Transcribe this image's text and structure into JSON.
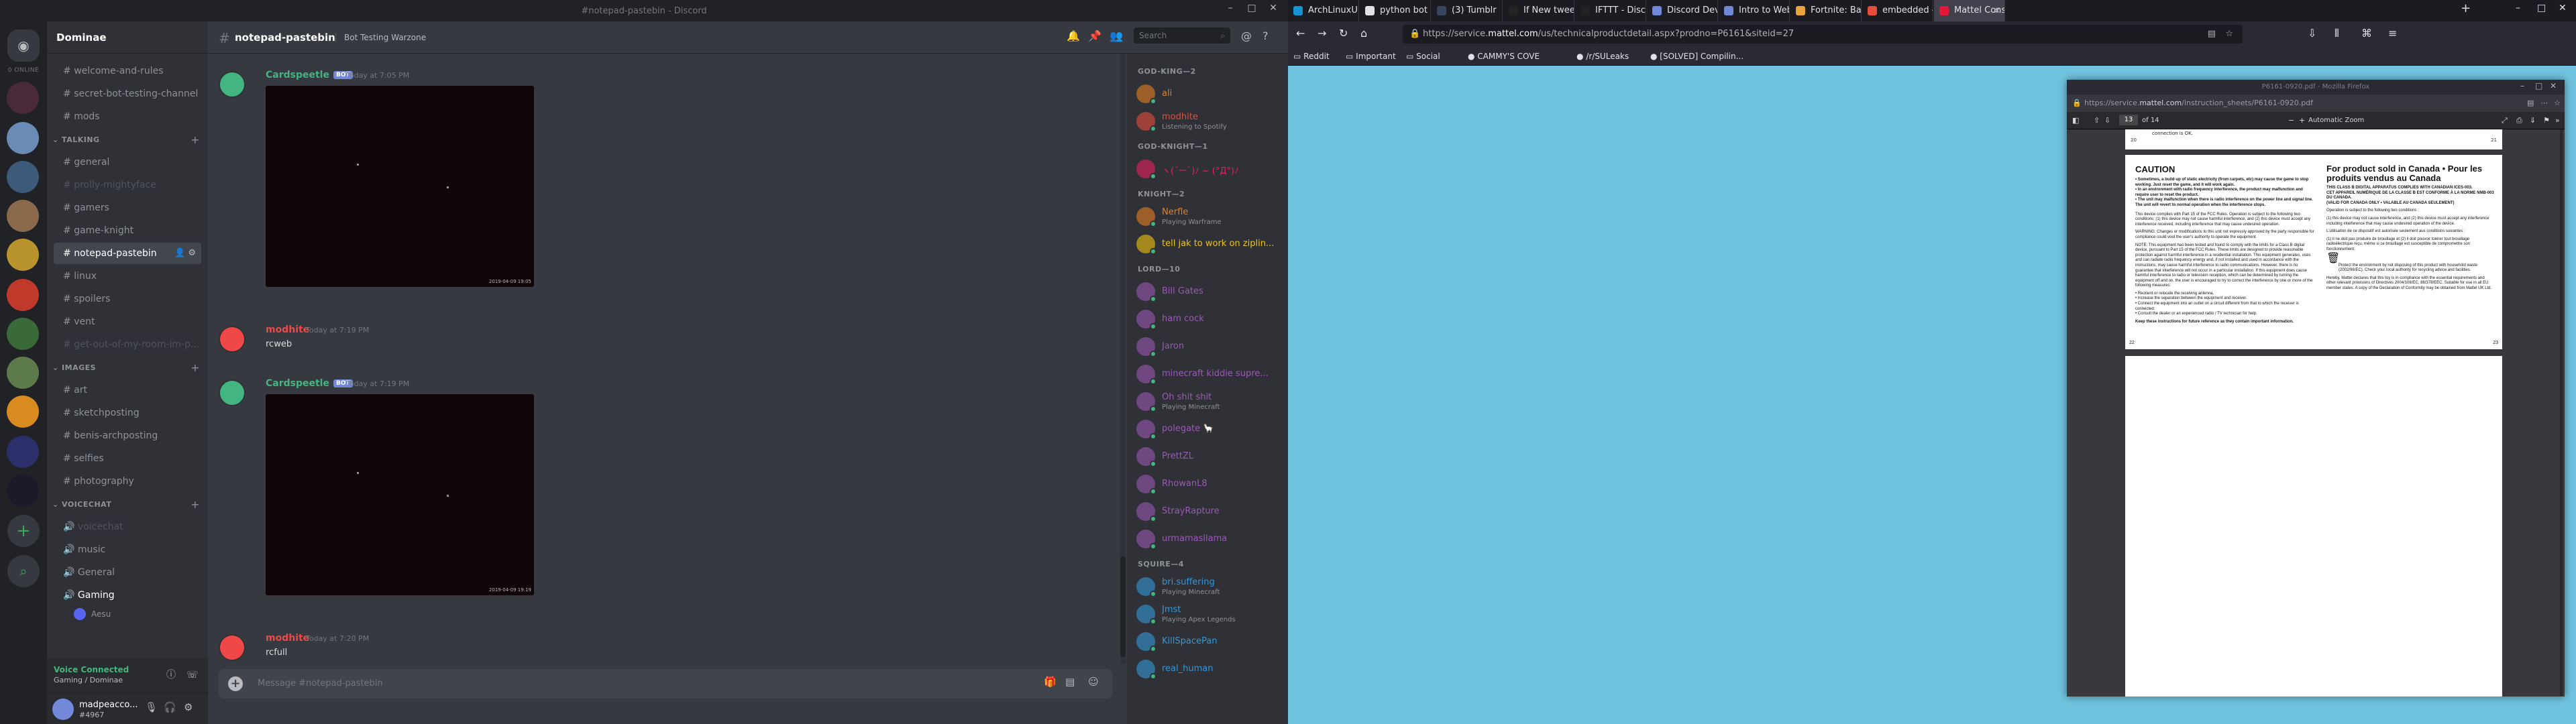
{
  "discord": {
    "window_title": "#notepad-pastebin - Discord",
    "servers_online_label": "0 ONLINE",
    "guild_name": "Dominae",
    "channels_top": [
      {
        "name": "welcome-and-rules",
        "state": "normal"
      },
      {
        "name": "secret-bot-testing-channel",
        "state": "normal"
      },
      {
        "name": "mods",
        "state": "normal"
      }
    ],
    "category_talking": "TALKING",
    "channels_talking": [
      {
        "name": "general",
        "state": "normal"
      },
      {
        "name": "prolly-mightyface",
        "state": "muted"
      },
      {
        "name": "gamers",
        "state": "normal"
      },
      {
        "name": "game-knight",
        "state": "normal"
      },
      {
        "name": "notepad-pastebin",
        "state": "active"
      },
      {
        "name": "linux",
        "state": "normal"
      },
      {
        "name": "spoilers",
        "state": "normal"
      },
      {
        "name": "vent",
        "state": "normal"
      },
      {
        "name": "get-out-of-my-room-im-p...",
        "state": "muted"
      }
    ],
    "category_images": "IMAGES",
    "channels_images": [
      {
        "name": "art"
      },
      {
        "name": "sketchposting"
      },
      {
        "name": "benis-archposting"
      },
      {
        "name": "selfies"
      },
      {
        "name": "photography"
      }
    ],
    "category_voice": "VOICECHAT",
    "channels_voice": [
      {
        "name": "voicechat",
        "state": "muted"
      },
      {
        "name": "music",
        "state": "normal"
      },
      {
        "name": "General",
        "state": "normal"
      },
      {
        "name": "Gaming",
        "state": "connected"
      }
    ],
    "voice_user": "Aesu",
    "voice_status": "Voice Connected",
    "voice_location": "Gaming / Dominae",
    "user": {
      "name": "madpeacco...",
      "tag": "#4967"
    },
    "chat": {
      "channel": "notepad-pastebin",
      "topic": "Bot Testing Warzone",
      "search_placeholder": "Search",
      "composer_placeholder": "Message #notepad-pastebin"
    },
    "messages": [
      {
        "author": "Cardspeetle",
        "bot": "BOT",
        "time": "Today at 7:05 PM",
        "text": "",
        "color": "#43b581",
        "has_image": true,
        "stamp": "2019-04-09 19:05"
      },
      {
        "author": "modhite",
        "bot": "",
        "time": "Today at 7:19 PM",
        "text": "rcweb",
        "color": "#f04747",
        "has_image": false
      },
      {
        "author": "Cardspeetle",
        "bot": "BOT",
        "time": "Today at 7:19 PM",
        "text": "",
        "color": "#43b581",
        "has_image": true,
        "stamp": "2019-04-09 19:19"
      },
      {
        "author": "modhite",
        "bot": "",
        "time": "Today at 7:20 PM",
        "text": "rcfull",
        "color": "#f04747",
        "has_image": false
      }
    ],
    "member_groups": [
      {
        "label": "GOD-KING—2",
        "members": [
          {
            "name": "ali",
            "sub": "",
            "color": "#e67e22"
          },
          {
            "name": "modhite",
            "sub": "Listening to Spotify",
            "color": "#e74c3c"
          }
        ]
      },
      {
        "label": "GOD-KNIGHT—1",
        "members": [
          {
            "name": "ヽ(´ー`)ﾉ ~ (°Д°)ﾉ",
            "sub": "",
            "color": "#e91e63"
          }
        ]
      },
      {
        "label": "KNIGHT—2",
        "members": [
          {
            "name": "Nerfle",
            "sub": "Playing Warframe",
            "color": "#e67e22"
          },
          {
            "name": "tell jak to work on ziplin...",
            "sub": "",
            "color": "#f1c40f"
          }
        ]
      },
      {
        "label": "LORD—10",
        "members": [
          {
            "name": "Bill Gates",
            "sub": "",
            "color": "#9b59b6"
          },
          {
            "name": "ham cock",
            "sub": "",
            "color": "#9b59b6"
          },
          {
            "name": "Jaron",
            "sub": "",
            "color": "#9b59b6"
          },
          {
            "name": "minecraft kiddie supre...",
            "sub": "",
            "color": "#9b59b6"
          },
          {
            "name": "Oh shit shit",
            "sub": "Playing Minecraft",
            "color": "#9b59b6"
          },
          {
            "name": "polegate 🦙",
            "sub": "",
            "color": "#9b59b6"
          },
          {
            "name": "PrettZL",
            "sub": "",
            "color": "#9b59b6"
          },
          {
            "name": "RhowanL8",
            "sub": "",
            "color": "#9b59b6"
          },
          {
            "name": "StrayRapture",
            "sub": "",
            "color": "#9b59b6"
          },
          {
            "name": "urmamasllama",
            "sub": "",
            "color": "#9b59b6"
          }
        ]
      },
      {
        "label": "SQUIRE—4",
        "members": [
          {
            "name": "bri.suffering",
            "sub": "Playing Minecraft",
            "color": "#3498db"
          },
          {
            "name": "Jmst",
            "sub": "Playing Apex Legends",
            "color": "#3498db"
          },
          {
            "name": "KillSpacePan",
            "sub": "",
            "color": "#3498db"
          },
          {
            "name": "real_human",
            "sub": "",
            "color": "#3498db"
          }
        ]
      }
    ]
  },
  "firefox": {
    "tabs": [
      {
        "label": "ArchLinuxUpdat...",
        "fav": "#1793d1"
      },
      {
        "label": "python bot auto...",
        "fav": "#e2e2e6"
      },
      {
        "label": "(3) Tumblr",
        "fav": "#36465d"
      },
      {
        "label": "If New tweet by...",
        "fav": "#222"
      },
      {
        "label": "IFTTT - Discord...",
        "fav": "#222"
      },
      {
        "label": "Discord Develo...",
        "fav": "#7289da"
      },
      {
        "label": "Intro to Webho...",
        "fav": "#7289da"
      },
      {
        "label": "Fortnite: Battle...",
        "fav": "#e8a33d"
      },
      {
        "label": "embedded - U...",
        "fav": "#e74c3c"
      },
      {
        "label": "Mattel Consum...",
        "fav": "#e31837",
        "active": true
      }
    ],
    "url_dim": "https://service.",
    "url_host": "mattel.com",
    "url_rest": "/us/technicalproductdetail.aspx?prodno=P6161&siteid=27",
    "bookmarks": [
      "Reddit",
      "Important",
      "Social",
      "CAMMY'S COVE",
      "/r/SULeaks",
      "[SOLVED] Compilin..."
    ],
    "pdf": {
      "window_title": "P6161-0920.pdf - Mozilla Firefox",
      "url_dim": "https://service.",
      "url_host": "mattel.com",
      "url_rest": "/instruction_sheets/P6161-0920.pdf",
      "page_current": "13",
      "page_total": "of 14",
      "zoom": "Automatic Zoom",
      "prev_left_num": "20",
      "prev_right_num": "21",
      "prev_text": "connection is OK.",
      "caution_title": "CAUTION",
      "caution_bullets": [
        "• Sometimes, a build-up of static electricity (from carpets, etc) may cause the game to stop working. Just reset the game, and it will work again.",
        "• In an environment with radio frequency interference, the product may malfunction and require user to reset the product.",
        "• The unit may malfunction when there is radio interference on the power line and signal line. The unit will revert to normal operation when the interference stops."
      ],
      "fcc_para": "This device complies with Part 15 of the FCC Rules. Operation is subject to the following two conditions: (1) this device may not cause harmful interference, and (2) this device must accept any interference received, including interference that may cause undesired operation.",
      "warning_para": "WARNING: Changes or modifications to this unit not expressly approved by the party responsible for compliance could void the user's authority to operate the equipment.",
      "note_para": "NOTE: This equipment has been tested and found to comply with the limits for a Class B digital device, pursuant to Part 15 of the FCC Rules. These limits are designed to provide reasonable protection against harmful interference in a residential installation. This equipment generates, uses and can radiate radio frequency energy and, if not installed and used in accordance with the instructions, may cause harmful interference to radio communications. However, there is no guarantee that interference will not occur in a particular installation. If this equipment does cause harmful interference to radio or television reception, which can be determined by turning the equipment off and on, the user is encouraged to try to correct the interference by one or more of the following measures:",
      "measures": [
        "• Reorient or relocate the receiving antenna.",
        "• Increase the separation between the equipment and receiver.",
        "• Connect the equipment into an outlet on a circuit different from that to which the receiver is connected.",
        "• Consult the dealer or an experienced radio / TV technician for help."
      ],
      "keep_para": "Keep these instructions for future reference as they contain important information.",
      "canada_title": "For product sold in Canada • Pour les produits vendus au Canada",
      "canada_lines": [
        "THIS CLASS B DIGITAL APPARATUS COMPLIES WITH CANADIAN ICES-003.",
        "CET APPAREIL NUMÉRIQUE DE LA CLASSE B EST CONFORME À LA NORME NMB-003 DU CANADA.",
        "(VALID FOR CANADA ONLY • VALABLE AU CANADA SEULEMENT)"
      ],
      "canada_para1": "Operation is subject to the following two conditions :",
      "canada_para2": "(1) this device may not cause interference, and (2) this device must accept any interference including interference that may cause undesired operation of the device.",
      "canada_para3": "L'utilisation de ce dispositif est autorisée seulement aux conditions suivantes :",
      "canada_para4": "(1) il ne doit pas produire de brouillage et (2) il doit pouvoir tolérer tout brouillage radioélectrique reçu, même si ce brouillage est susceptible de compromettre son fonctionnement.",
      "env_para": "Protect the environment by not disposing of this product with household waste (2002/96/EC). Check your local authority for recycling advice and facilities.",
      "mattel_para": "Hereby, Mattel declares that this toy is in compliance with the essential requirements and other relevant provisions of Directives 2004/108/EC, 88/378/EEC. Suitable for use in all EU member states. A copy of the Declaration of Conformity may be obtained from Mattel UK Ltd.",
      "page_left_num": "22",
      "page_right_num": "23"
    }
  }
}
